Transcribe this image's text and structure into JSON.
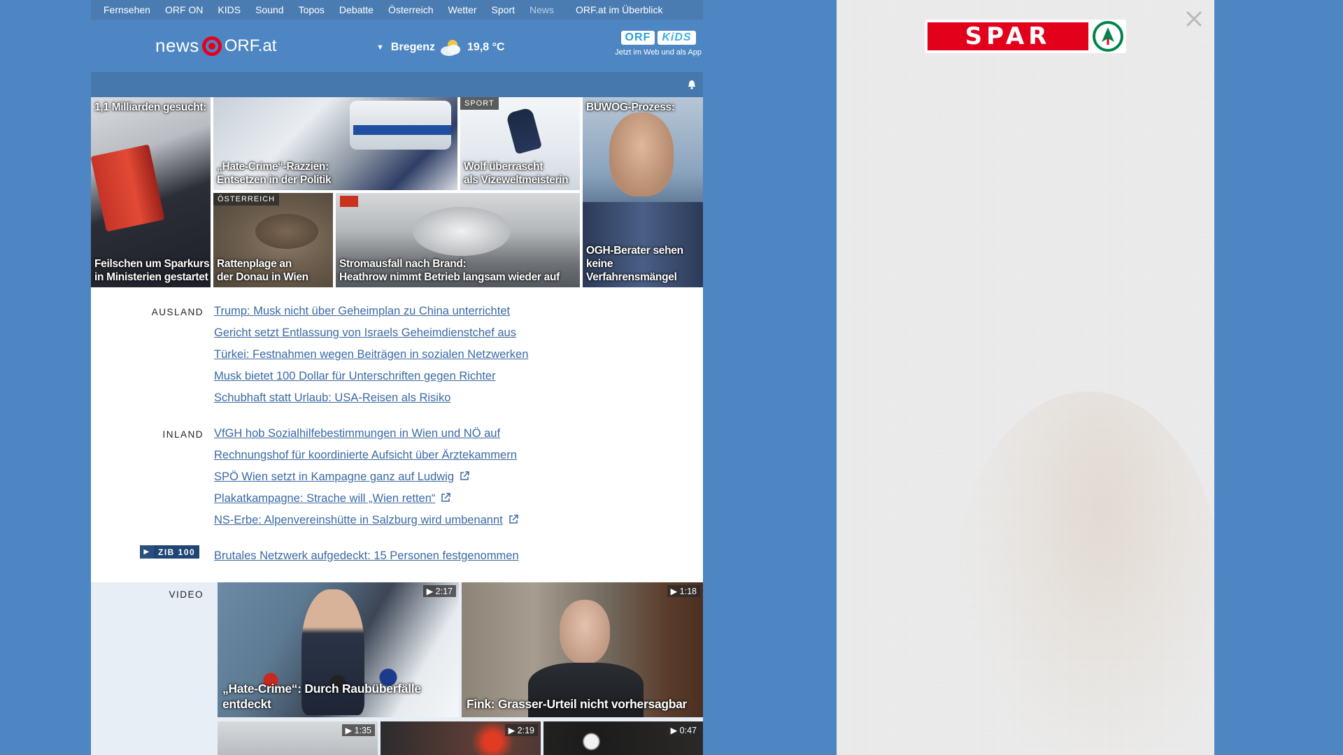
{
  "topnav": [
    {
      "label": "Fernsehen",
      "dim": false
    },
    {
      "label": "ORF ON",
      "dim": false
    },
    {
      "label": "KIDS",
      "dim": false
    },
    {
      "label": "Sound",
      "dim": false
    },
    {
      "label": "Topos",
      "dim": false
    },
    {
      "label": "Debatte",
      "dim": false
    },
    {
      "label": "Österreich",
      "dim": false
    },
    {
      "label": "Wetter",
      "dim": false
    },
    {
      "label": "Sport",
      "dim": false
    },
    {
      "label": "News",
      "dim": true
    }
  ],
  "topnav_overview": "ORF.at im Überblick",
  "header": {
    "logo_news": "news",
    "logo_orf": "ORF.at",
    "weather_city": "Bregenz",
    "weather_temp": "19,8 °C",
    "weather_icon": "partly-cloudy-icon",
    "kids_orf": "ORF",
    "kids_kids": "KiDS",
    "kids_caption": "Jetzt im Web und als App"
  },
  "mosaic": {
    "t1_top": "1,1 Milliarden gesucht:",
    "t1_cap": [
      "Feilschen um Sparkurs",
      "in Ministerien gestartet"
    ],
    "t2_cap": [
      "„Hate-Crime“-Razzien:",
      "Entsetzen in der Politik"
    ],
    "t3_tag": "SPORT",
    "t3_cap": [
      "Wolf überrascht",
      "als Vizeweltmeisterin"
    ],
    "t4_top": "BUWOG-Prozess:",
    "t4_cap": [
      "OGH-Berater sehen",
      "keine Verfahrensmängel"
    ],
    "t5_tag": "ÖSTERREICH",
    "t5_cap": [
      "Rattenplage an",
      "der Donau in Wien"
    ],
    "t6_cap": [
      "Stromausfall nach Brand:",
      "Heathrow nimmt Betrieb langsam wieder auf"
    ]
  },
  "ausland": {
    "label": "AUSLAND",
    "items": [
      "Trump: Musk nicht über Geheimplan zu China unterrichtet",
      "Gericht setzt Entlassung von Israels Geheimdienstchef aus",
      "Türkei: Festnahmen wegen Beiträgen in sozialen Netzwerken",
      "Musk bietet 100 Dollar für Unterschriften gegen Richter",
      "Schubhaft statt Urlaub: USA-Reisen als Risiko"
    ]
  },
  "inland": {
    "label": "INLAND",
    "items": [
      "VfGH hob Sozialhilfebestimmungen in Wien und NÖ auf",
      "Rechnungshof für koordinierte Aufsicht über Ärztekammern",
      "SPÖ Wien setzt in Kampagne ganz auf Ludwig",
      "Plakatkampagne: Strache will „Wien retten“",
      "NS-Erbe: Alpenvereinshütte in Salzburg wird umbenannt"
    ]
  },
  "zib": {
    "badge": "ZIB 100",
    "headline": "Brutales Netzwerk aufgedeckt: 15 Personen festgenommen"
  },
  "video": {
    "label": "VIDEO",
    "v1_duration": "2:17",
    "v1_cap": [
      "„Hate-Crime“: Durch Raubüberfälle",
      "entdeckt"
    ],
    "v2_duration": "1:18",
    "v2_cap": [
      "Fink: Grasser-Urteil nicht vorhersagbar"
    ],
    "v3_duration": "1:35",
    "v4_duration": "2:19",
    "v5_duration": "0:47"
  },
  "ad": {
    "brand": "SPAR"
  },
  "colors": {
    "page_bg": "#4d86c3",
    "link": "#3a6aa5",
    "spar_red": "#e3001b",
    "spar_green": "#00844a"
  }
}
